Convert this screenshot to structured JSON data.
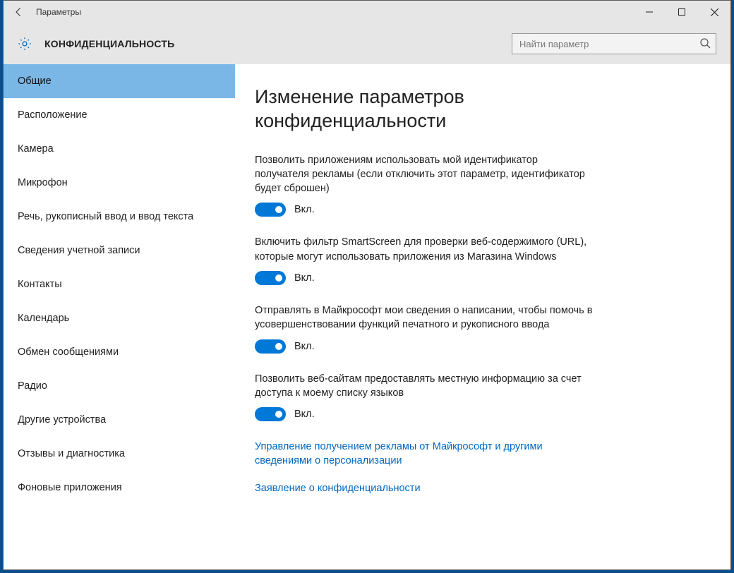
{
  "window_title": "Параметры",
  "section_title": "КОНФИДЕНЦИАЛЬНОСТЬ",
  "search": {
    "placeholder": "Найти параметр"
  },
  "sidebar": {
    "items": [
      {
        "label": "Общие",
        "active": true
      },
      {
        "label": "Расположение"
      },
      {
        "label": "Камера"
      },
      {
        "label": "Микрофон"
      },
      {
        "label": "Речь, рукописный ввод и ввод текста"
      },
      {
        "label": "Сведения учетной записи"
      },
      {
        "label": "Контакты"
      },
      {
        "label": "Календарь"
      },
      {
        "label": "Обмен сообщениями"
      },
      {
        "label": "Радио"
      },
      {
        "label": "Другие устройства"
      },
      {
        "label": "Отзывы и диагностика"
      },
      {
        "label": "Фоновые приложения"
      }
    ]
  },
  "content": {
    "heading": "Изменение параметров конфиденциальности",
    "settings": [
      {
        "desc": "Позволить приложениям использовать мой идентификатор получателя рекламы (если отключить этот параметр, идентификатор будет сброшен)",
        "state_label": "Вкл."
      },
      {
        "desc": "Включить фильтр SmartScreen для проверки веб-содержимого (URL), которые могут использовать приложения из Магазина Windows",
        "state_label": "Вкл."
      },
      {
        "desc": "Отправлять в Майкрософт мои сведения о написании, чтобы помочь в усовершенствовании функций печатного и рукописного ввода",
        "state_label": "Вкл."
      },
      {
        "desc": "Позволить веб-сайтам предоставлять местную информацию за счет доступа к моему списку языков",
        "state_label": "Вкл."
      }
    ],
    "links": [
      {
        "text": "Управление получением рекламы от Майкрософт и другими сведениями о персонализации"
      },
      {
        "text": "Заявление о конфиденциальности"
      }
    ]
  }
}
